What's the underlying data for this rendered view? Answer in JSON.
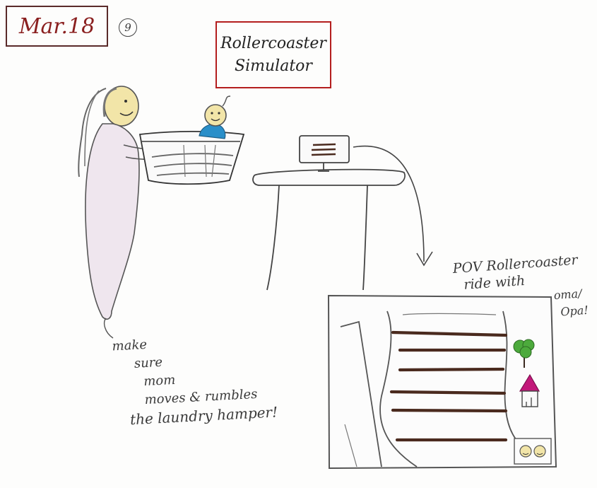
{
  "date_label": "Mar.18",
  "page_number": "9",
  "title": {
    "line1": "Rollercoaster",
    "line2": "Simulator"
  },
  "note_left": {
    "line1": "make",
    "line2": "sure",
    "line3": "mom",
    "line4": "moves & rumbles",
    "line5": "the laundry hamper!"
  },
  "note_right": {
    "line1": "POV Rollercoaster",
    "line2": "ride with",
    "line3": "oma/",
    "line4": "Opa!"
  },
  "colors": {
    "date_ink": "#8a1f1f",
    "title_frame": "#b41e1e",
    "pencil": "#444444",
    "baby_shirt": "#2a8fc9",
    "face_skin": "#f2e5a8",
    "tree_green": "#4caa3c",
    "house_roof": "#c2187a",
    "track_stripe": "#4a2a1e"
  }
}
